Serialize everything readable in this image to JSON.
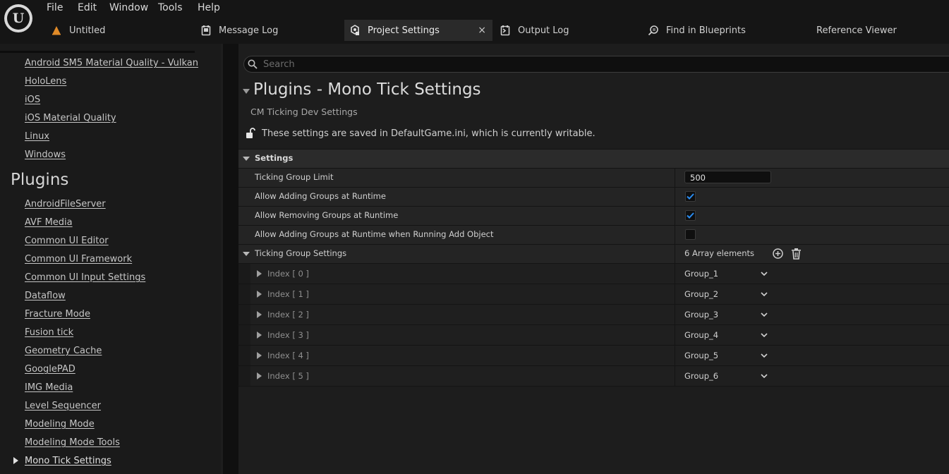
{
  "menu": {
    "items": [
      "File",
      "Edit",
      "Window",
      "Tools",
      "Help"
    ]
  },
  "tabs": [
    {
      "label": "Untitled",
      "icon": "level-icon"
    },
    {
      "label": "Message Log",
      "icon": "message-log-icon"
    },
    {
      "label": "Project Settings",
      "icon": "settings-icon",
      "active": true,
      "close": "×"
    },
    {
      "label": "Output Log",
      "icon": "output-log-icon"
    },
    {
      "label": "Find in Blueprints",
      "icon": "find-icon"
    },
    {
      "label": "Reference Viewer",
      "icon": ""
    }
  ],
  "sidebar": {
    "platform_items": [
      "Android SM5 Material Quality - Vulkan",
      "HoloLens",
      "iOS",
      "iOS Material Quality",
      "Linux",
      "Windows"
    ],
    "plugins_heading": "Plugins",
    "plugin_items": [
      "AndroidFileServer",
      "AVF Media",
      "Common UI Editor",
      "Common UI Framework",
      "Common UI Input Settings",
      "Dataflow",
      "Fracture Mode",
      "Fusion tick",
      "Geometry Cache",
      "GooglePAD",
      "IMG Media",
      "Level Sequencer",
      "Modeling Mode",
      "Modeling Mode Tools",
      "Mono Tick Settings"
    ],
    "selected": "Mono Tick Settings"
  },
  "main": {
    "search_placeholder": "Search",
    "title": "Plugins - Mono Tick Settings",
    "subtitle": "CM Ticking Dev Settings",
    "notice": "These settings are saved in DefaultGame.ini, which is currently writable.",
    "section_label": "Settings",
    "properties": {
      "ticking_group_limit": {
        "label": "Ticking Group Limit",
        "value": "500"
      },
      "allow_adding": {
        "label": "Allow Adding Groups at Runtime",
        "checked": true
      },
      "allow_removing": {
        "label": "Allow Removing Groups at Runtime",
        "checked": true
      },
      "allow_adding_add_object": {
        "label": "Allow Adding Groups at Runtime when Running Add Object",
        "checked": false
      },
      "ticking_group_settings": {
        "label": "Ticking Group Settings",
        "count": "6 Array elements"
      }
    },
    "array_items": [
      {
        "index": "Index [ 0 ]",
        "value": "Group_1"
      },
      {
        "index": "Index [ 1 ]",
        "value": "Group_2"
      },
      {
        "index": "Index [ 2 ]",
        "value": "Group_3"
      },
      {
        "index": "Index [ 3 ]",
        "value": "Group_4"
      },
      {
        "index": "Index [ 4 ]",
        "value": "Group_5"
      },
      {
        "index": "Index [ 5 ]",
        "value": "Group_6"
      }
    ]
  },
  "colors": {
    "checkbox_accent": "#2a8cf0",
    "untitled_icon": "#e08a28"
  }
}
